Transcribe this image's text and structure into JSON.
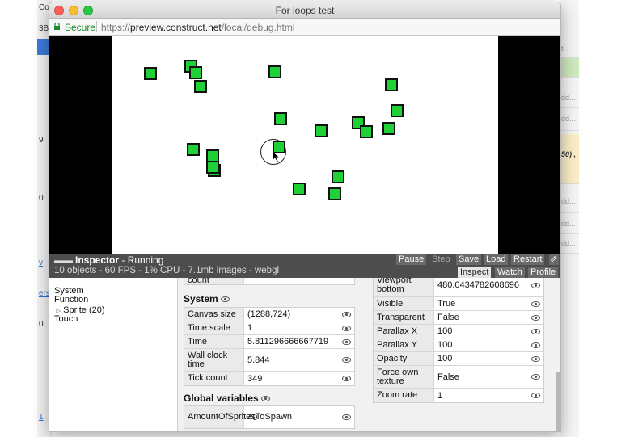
{
  "window": {
    "title": "For loops test"
  },
  "address_bar": {
    "secure_label": "Secure",
    "url_scheme": "https://",
    "url_host": "preview.construct.net",
    "url_path": "/local/debug.html"
  },
  "game": {
    "sprite_color": "#1ed136",
    "sprite_count_visible": 20
  },
  "inspector": {
    "title": "Inspector",
    "state": "- Running",
    "stats": "10 objects - 60 FPS - 1% CPU - 7.1mb images - webgl",
    "buttons": {
      "pause": "Pause",
      "step": "Step",
      "save": "Save",
      "load": "Load",
      "restart": "Restart"
    },
    "tabs": {
      "inspect": "Inspect",
      "watch": "Watch",
      "profile": "Profile"
    },
    "active_tab": "Inspect",
    "tree": {
      "system": "System",
      "function": "Function",
      "sprite": "Sprite (20)",
      "touch": "Touch"
    },
    "partial_top_label": "count",
    "system": {
      "heading": "System",
      "rows": [
        {
          "key": "Canvas size",
          "value": "(1288,724)"
        },
        {
          "key": "Time scale",
          "value": "1"
        },
        {
          "key": "Time",
          "value": "5.811296666667719"
        },
        {
          "key": "Wall clock time",
          "value": "5.844"
        },
        {
          "key": "Tick count",
          "value": "349"
        }
      ]
    },
    "globals": {
      "heading": "Global variables",
      "rows": [
        {
          "key": "AmountOfSpritesToSpawn",
          "value": "40"
        }
      ]
    },
    "layer": {
      "rows": [
        {
          "key": "Viewport bottom",
          "value": "480.0434782608696"
        },
        {
          "key": "Visible",
          "value": "True"
        },
        {
          "key": "Transparent",
          "value": "False"
        },
        {
          "key": "Parallax X",
          "value": "100"
        },
        {
          "key": "Parallax Y",
          "value": "100"
        },
        {
          "key": "Opacity",
          "value": "100"
        },
        {
          "key": "Force own texture",
          "value": "False"
        },
        {
          "key": "Zoom rate",
          "value": "1"
        }
      ]
    }
  },
  "background_app": {
    "left_text": [
      "Co",
      "3B)",
      "9",
      "0",
      "v",
      "ers",
      "0",
      "1"
    ],
    "right_text": [
      "t",
      "dd...",
      "dd...",
      "50) ,",
      "dd...",
      "dd...",
      "dd..."
    ]
  }
}
